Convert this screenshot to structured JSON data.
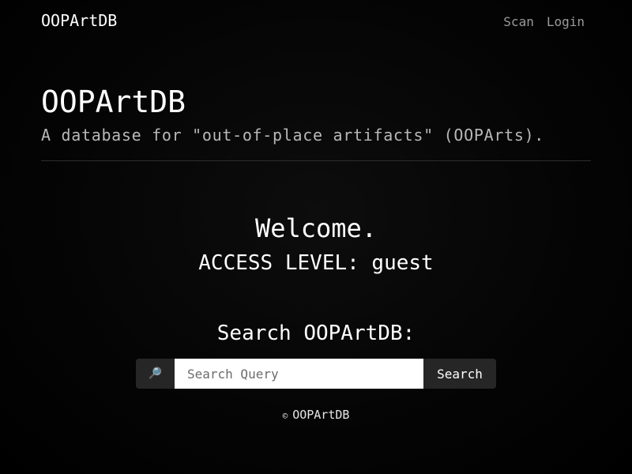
{
  "navbar": {
    "brand": "OOPArtDB",
    "links": [
      {
        "label": "Scan"
      },
      {
        "label": "Login"
      }
    ]
  },
  "hero": {
    "title": "OOPArtDB",
    "subtitle": "A database for \"out-of-place artifacts\" (OOPArts)."
  },
  "welcome": {
    "heading": "Welcome.",
    "access_level": "ACCESS LEVEL: guest"
  },
  "search": {
    "heading": "Search OOPArtDB:",
    "prefix_icon": "magnifying-glass-icon",
    "prefix_glyph": "🔎",
    "placeholder": "Search Query",
    "value": "",
    "button_label": "Search"
  },
  "footer": {
    "copyright_symbol": "©",
    "text": "OOPArtDB"
  },
  "colors": {
    "background": "#000000",
    "text": "#ffffff",
    "muted_text": "#9a9a9a",
    "subtitle_text": "#b8b8b8",
    "divider": "#2e2e2e",
    "input_addon": "#262626",
    "input_background": "#ffffff"
  }
}
